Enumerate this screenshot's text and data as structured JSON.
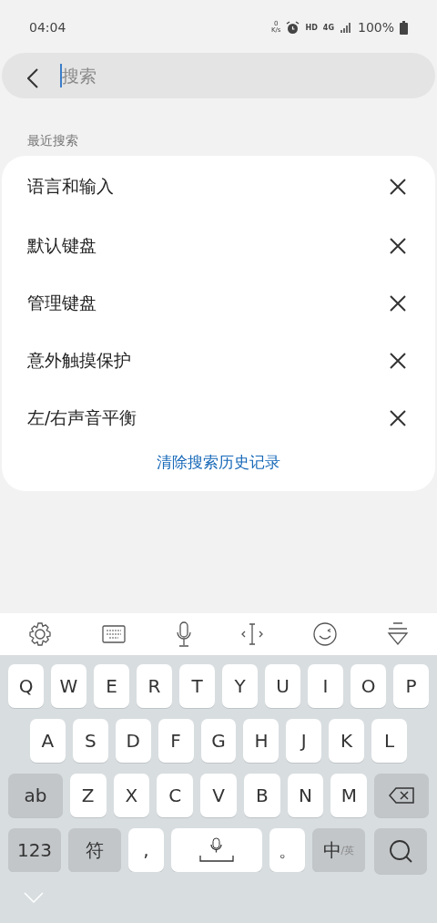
{
  "status_bar": {
    "time": "04:04",
    "net_speed_value": "0",
    "net_speed_unit": "K/s",
    "hd": "HD",
    "network": "4G",
    "battery": "100%"
  },
  "search": {
    "placeholder": "搜索"
  },
  "recent": {
    "heading": "最近搜索",
    "items": [
      {
        "label": "语言和输入"
      },
      {
        "label": "默认键盘"
      },
      {
        "label": "管理键盘"
      },
      {
        "label": "意外触摸保护"
      },
      {
        "label": "左/右声音平衡"
      }
    ],
    "clear_link": "清除搜索历史记录"
  },
  "keyboard": {
    "rows": [
      {
        "keys": [
          {
            "kind": "char",
            "label": "Q"
          },
          {
            "kind": "char",
            "label": "W"
          },
          {
            "kind": "char",
            "label": "E"
          },
          {
            "kind": "char",
            "label": "R"
          },
          {
            "kind": "char",
            "label": "T"
          },
          {
            "kind": "char",
            "label": "Y"
          },
          {
            "kind": "char",
            "label": "U"
          },
          {
            "kind": "char",
            "label": "I"
          },
          {
            "kind": "char",
            "label": "O"
          },
          {
            "kind": "char",
            "label": "P"
          }
        ]
      },
      {
        "keys": [
          {
            "kind": "char",
            "label": "A"
          },
          {
            "kind": "char",
            "label": "S"
          },
          {
            "kind": "char",
            "label": "D"
          },
          {
            "kind": "char",
            "label": "F"
          },
          {
            "kind": "char",
            "label": "G"
          },
          {
            "kind": "char",
            "label": "H"
          },
          {
            "kind": "char",
            "label": "J"
          },
          {
            "kind": "char",
            "label": "K"
          },
          {
            "kind": "char",
            "label": "L"
          }
        ]
      },
      {
        "keys": [
          {
            "kind": "func",
            "label": "ab"
          },
          {
            "kind": "char",
            "label": "Z"
          },
          {
            "kind": "char",
            "label": "X"
          },
          {
            "kind": "char",
            "label": "C"
          },
          {
            "kind": "char",
            "label": "V"
          },
          {
            "kind": "char",
            "label": "B"
          },
          {
            "kind": "char",
            "label": "N"
          },
          {
            "kind": "char",
            "label": "M"
          },
          {
            "kind": "backspace"
          }
        ]
      },
      {
        "keys": [
          {
            "kind": "func",
            "label": "123"
          },
          {
            "kind": "func",
            "label": "符"
          },
          {
            "kind": "char",
            "label": ","
          },
          {
            "kind": "space"
          },
          {
            "kind": "char",
            "label": "。"
          },
          {
            "kind": "lang",
            "label": "中",
            "sub": "/英"
          },
          {
            "kind": "search"
          }
        ]
      }
    ]
  }
}
